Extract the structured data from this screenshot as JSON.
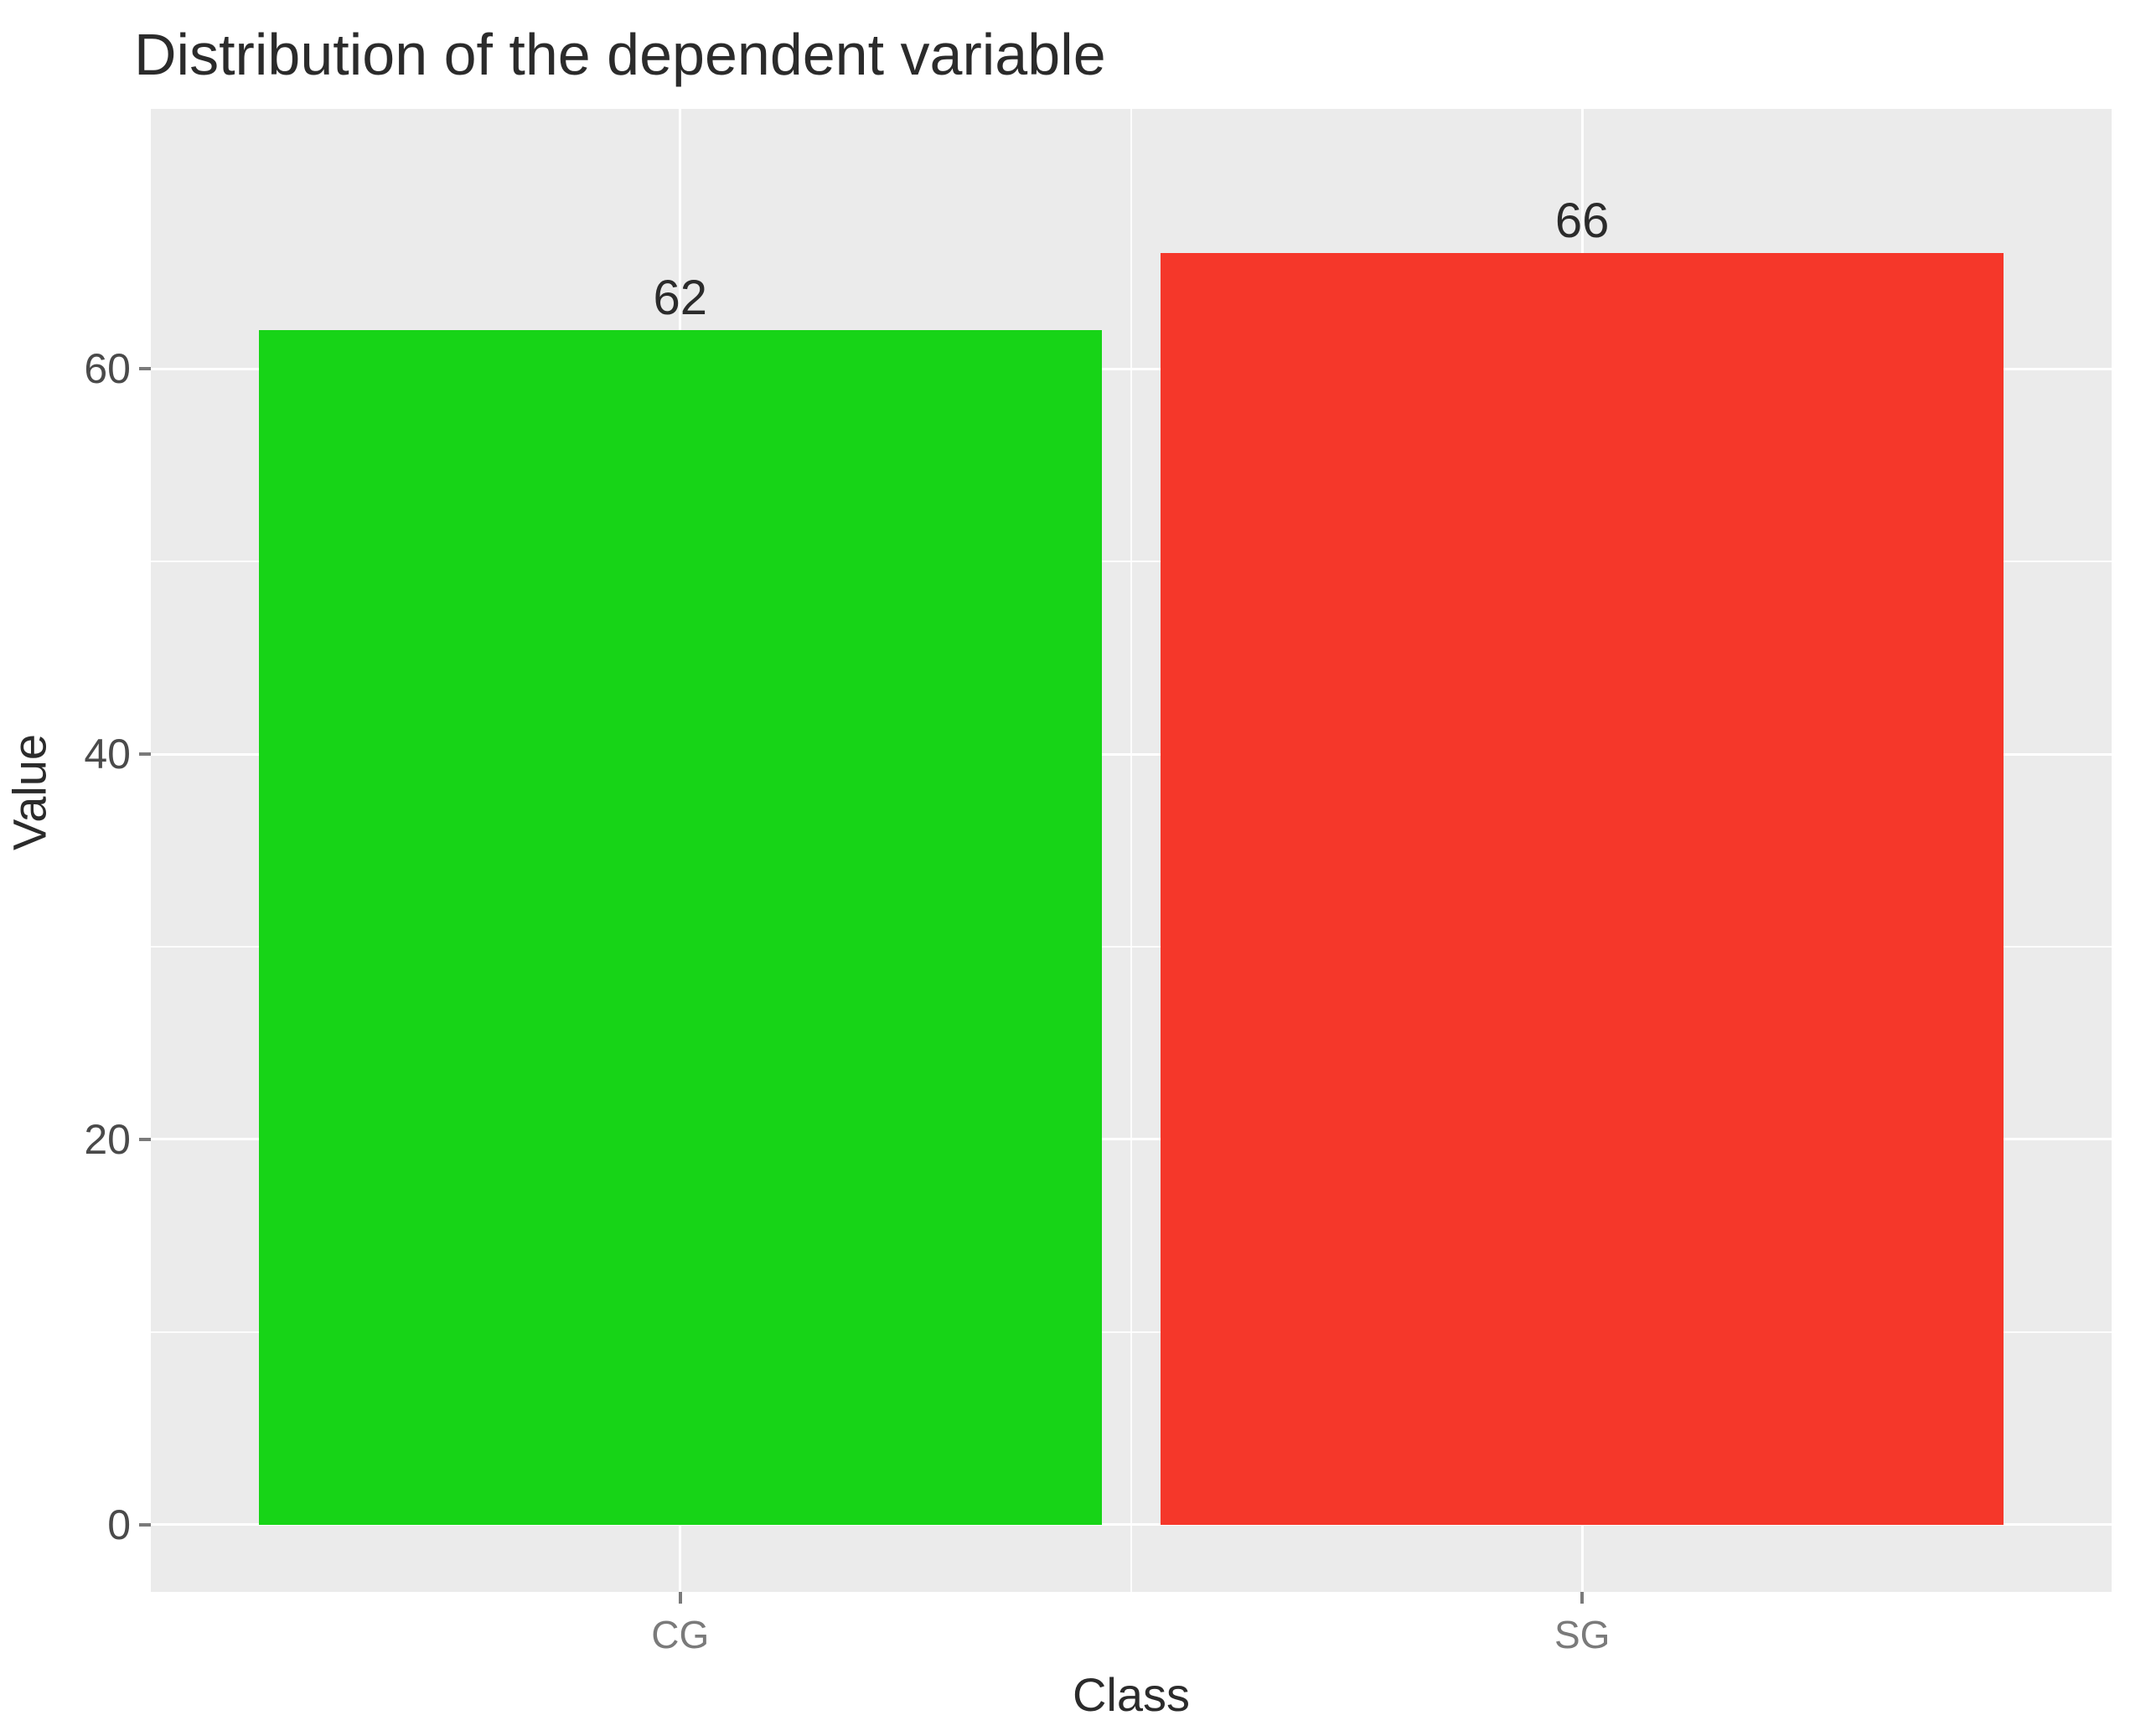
{
  "chart_data": {
    "type": "bar",
    "title": "Distribution of the dependent variable",
    "xlabel": "Class",
    "ylabel": "Value",
    "categories": [
      "CG",
      "SG"
    ],
    "values": [
      62,
      66
    ],
    "data_labels": [
      "62",
      "66"
    ],
    "y_ticks": [
      0,
      20,
      40,
      60
    ],
    "y_minor_ticks": [
      10,
      30,
      50
    ],
    "ylim": [
      0,
      70
    ],
    "bar_colors": [
      "#17d417",
      "#f5372a"
    ],
    "panel_bg": "#ebebeb",
    "grid_color": "#ffffff"
  }
}
